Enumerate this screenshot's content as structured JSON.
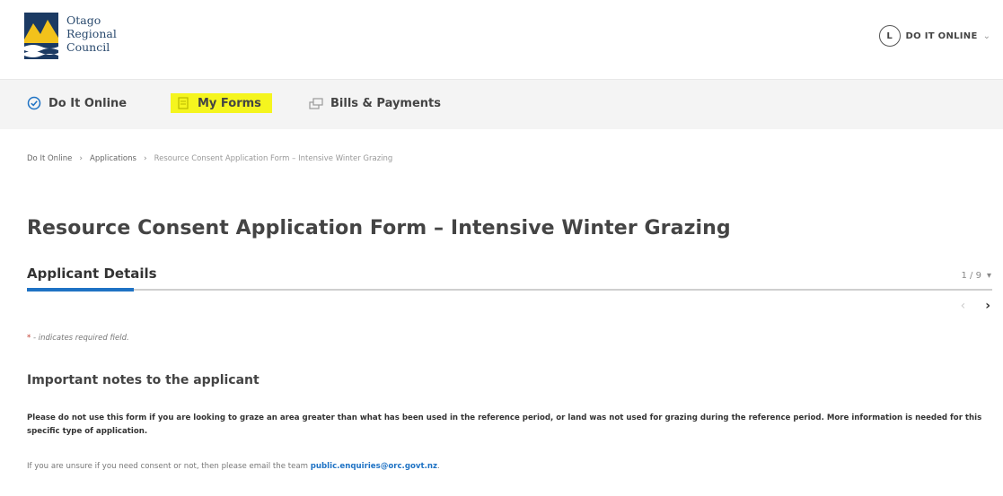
{
  "header": {
    "logo_lines": [
      "Otago",
      "Regional",
      "Council"
    ],
    "user_initial": "L",
    "menu_label": "DO IT ONLINE",
    "menu_chevron": "⌄"
  },
  "nav": {
    "items": [
      {
        "label": "Do It Online",
        "icon": "check-circle-icon"
      },
      {
        "label": "My Forms",
        "icon": "forms-icon"
      },
      {
        "label": "Bills & Payments",
        "icon": "payment-icon"
      }
    ],
    "highlight_color": "#f5f51e"
  },
  "breadcrumb": {
    "items": [
      "Do It Online",
      "Applications",
      "Resource Consent Application Form – Intensive Winter Grazing"
    ],
    "separator": "›"
  },
  "page": {
    "title": "Resource Consent Application Form – Intensive Winter Grazing",
    "section_title": "Applicant Details",
    "step": "1 / 9",
    "step_chevron": "▾",
    "progress_fraction": 0.111,
    "pager_prev": "‹",
    "pager_next": "›",
    "required_star": "*",
    "required_note": "- indicates required field.",
    "notes_heading": "Important notes to the applicant",
    "notes_text": "Please do not use this form if you are looking to graze an area greater than what has been used in the reference period, or land was not used for grazing during the reference period. More information is needed for this specific type of application.",
    "email_text": "If you are unsure if you need consent or not, then please email the team ",
    "email_link": "public.enquiries@orc.govt.nz",
    "email_suffix": "."
  },
  "colors": {
    "accent": "#1e72c4",
    "required": "#c0392b"
  }
}
